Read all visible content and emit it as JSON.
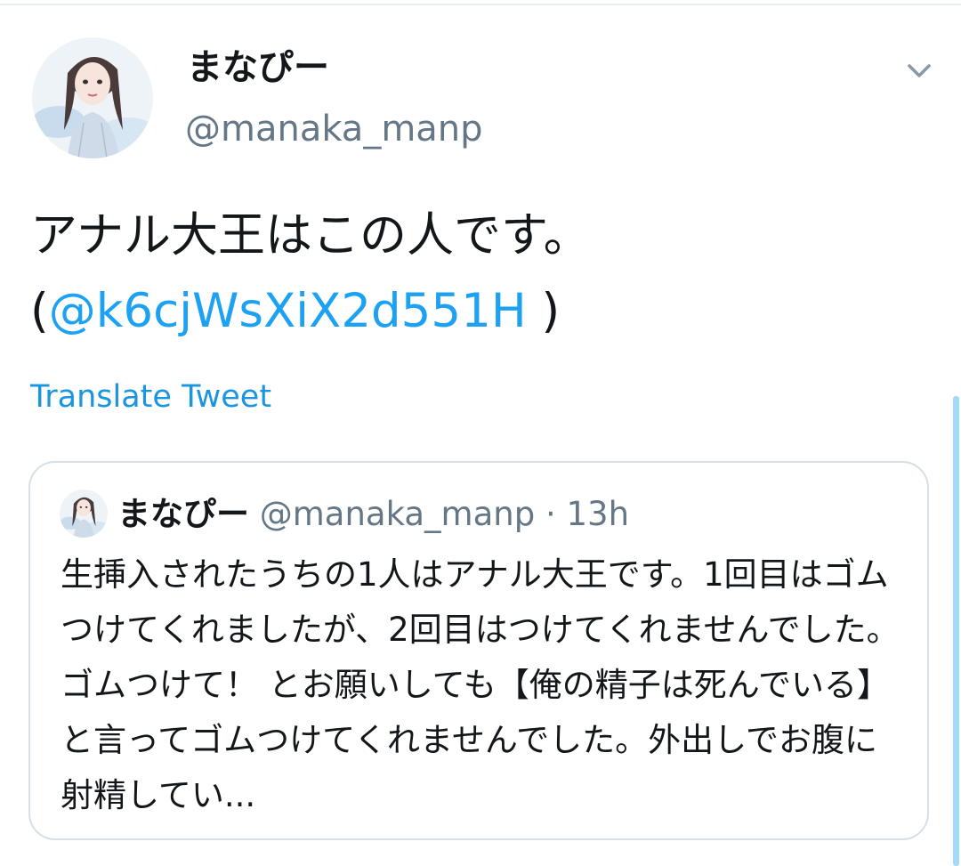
{
  "tweet": {
    "author": {
      "display_name": "まなぴー",
      "handle": "@manaka_manp"
    },
    "text_main": "アナル大王はこの人です。",
    "paren_open": "(",
    "mention": "@k6cjWsXiX2d551H",
    "paren_close": " )",
    "translate_label": "Translate Tweet"
  },
  "quoted": {
    "display_name": "まなぴー",
    "handle": "@manaka_manp",
    "separator": " · ",
    "time": "13h",
    "text": "生挿入されたうちの1人はアナル大王です。1回目はゴムつけてくれましたが、2回目はつけてくれませんでした。ゴムつけて！ とお願いしても【俺の精子は死んでいる】と言ってゴムつけてくれませんでした。外出しでお腹に射精してい..."
  },
  "icons": {
    "menu": "chevron-down-icon",
    "avatar": "profile-avatar"
  },
  "colors": {
    "link": "#1da1f2",
    "secondary": "#657786",
    "border": "#d8dfe5",
    "scrollbar": "#a4d9f7"
  }
}
